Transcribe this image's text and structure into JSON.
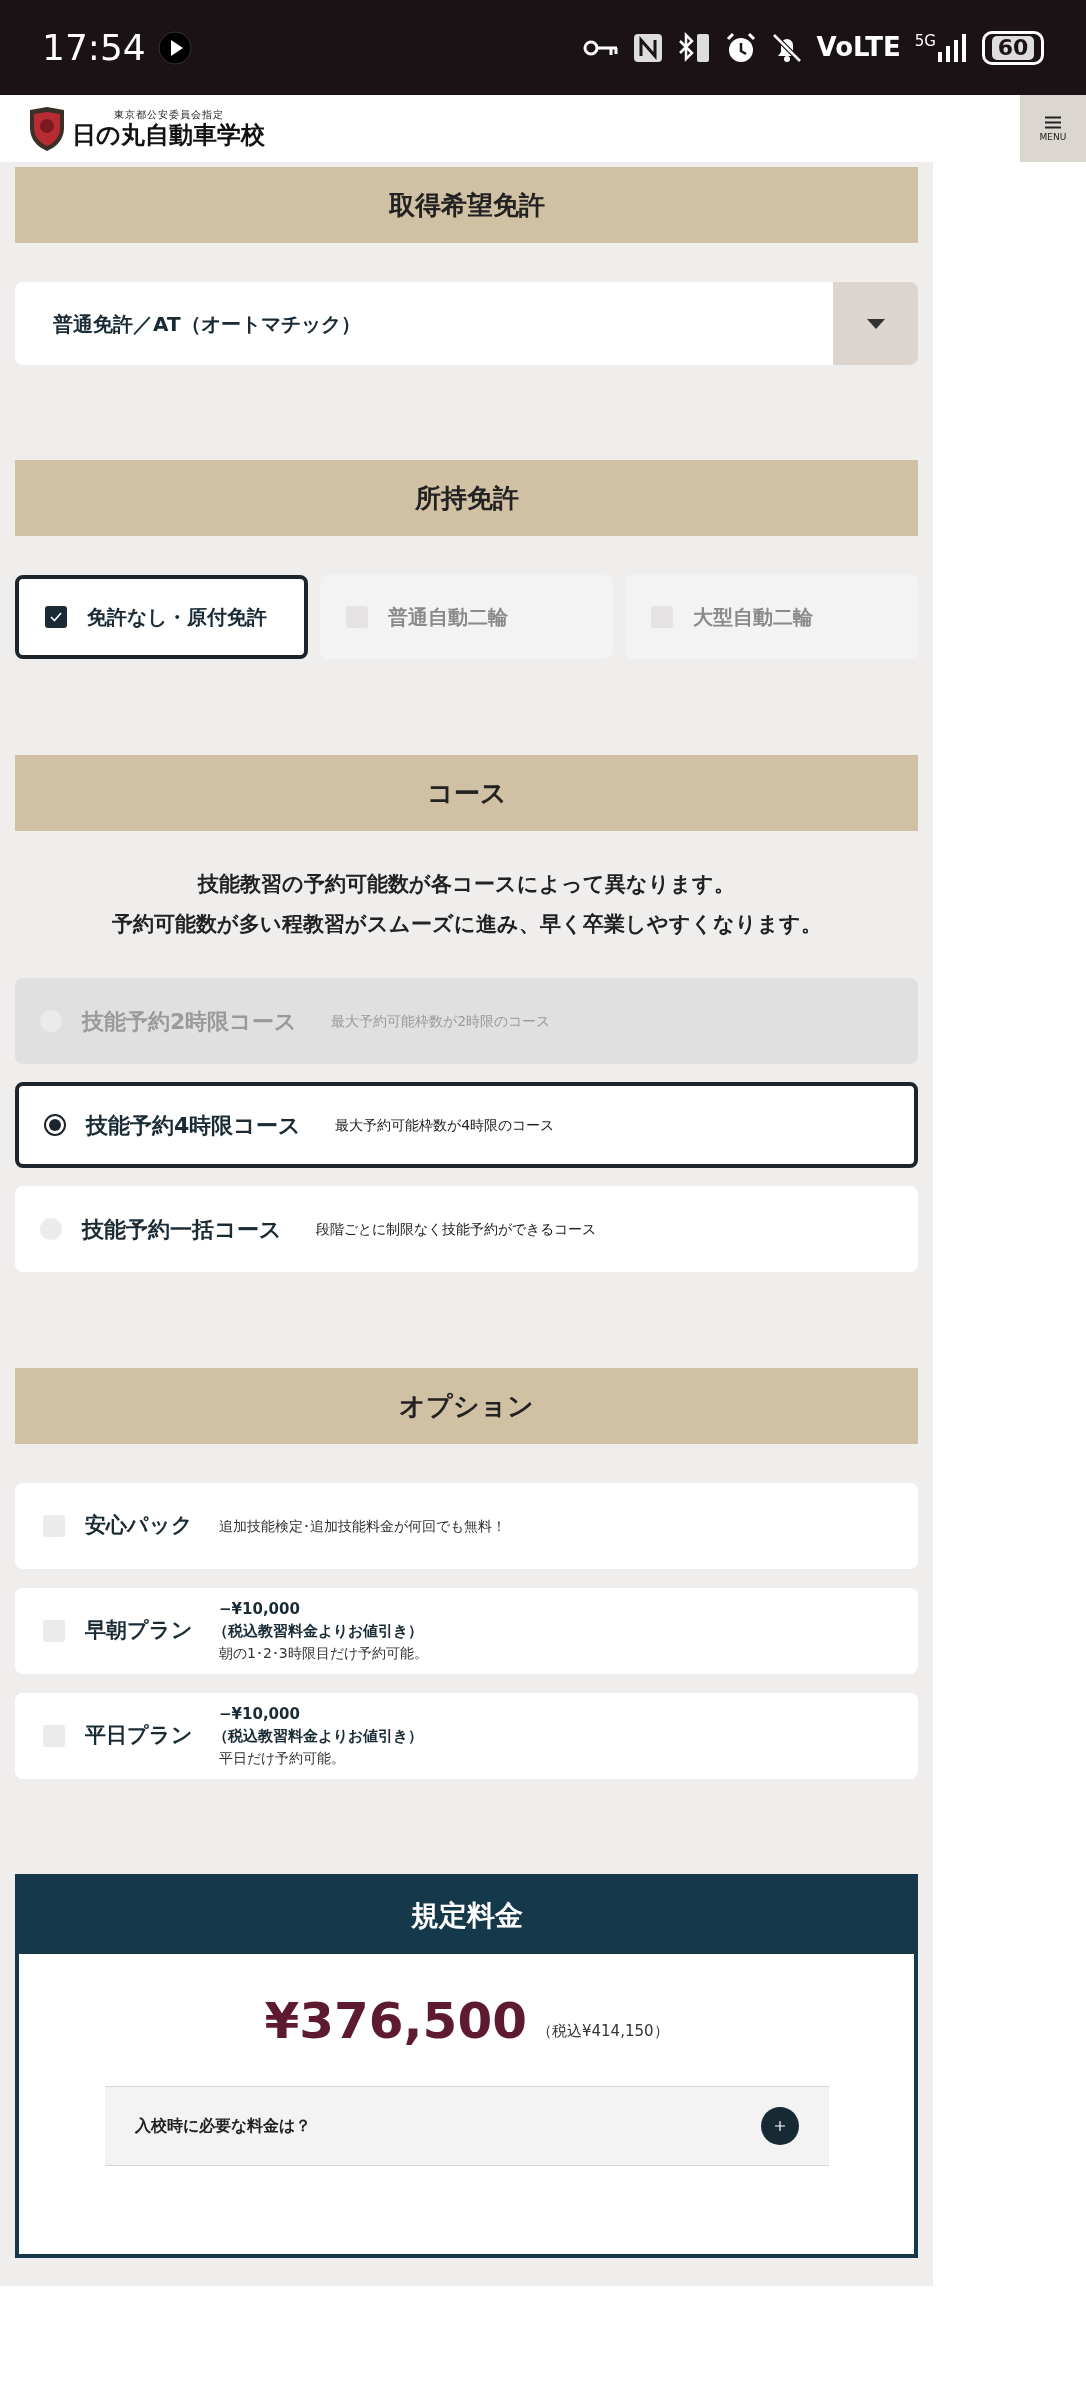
{
  "status_bar": {
    "time": "17:54",
    "network_label": "VoLTE",
    "network_type": "5G",
    "battery": "60"
  },
  "header": {
    "logo_caption": "東京都公安委員会指定",
    "logo_text": "日の丸自動車学校",
    "menu_label": "MENU"
  },
  "desired_license": {
    "heading": "取得希望免許",
    "select_value": "普通免許／AT（オートマチック）"
  },
  "held_license": {
    "heading": "所持免許",
    "options": [
      {
        "label": "免許なし・原付免許",
        "checked": true,
        "disabled": false
      },
      {
        "label": "普通自動二輪",
        "checked": false,
        "disabled": true
      },
      {
        "label": "大型自動二輪",
        "checked": false,
        "disabled": true
      }
    ]
  },
  "course": {
    "heading": "コース",
    "description_lines": [
      "技能教習の予約可能数が各コースによって異なります。",
      "予約可能数が多い程教習がスムーズに進み、早く卒業しやすくなります。"
    ],
    "courses": [
      {
        "name": "技能予約2時限コース",
        "note": "最大予約可能枠数が2時限のコース",
        "selected": false,
        "disabled": true
      },
      {
        "name": "技能予約4時限コース",
        "note": "最大予約可能枠数が4時限のコース",
        "selected": true,
        "disabled": false
      },
      {
        "name": "技能予約一括コース",
        "note": "段階ごとに制限なく技能予約ができるコース",
        "selected": false,
        "disabled": false
      }
    ]
  },
  "options": {
    "heading": "オプション",
    "items": [
      {
        "name": "安心パック",
        "checked": false,
        "detail": "追加技能検定･追加技能料金が何回でも無料！"
      },
      {
        "name": "早朝プラン",
        "checked": false,
        "discount": "−¥10,000",
        "discount_note": "（税込教習料金よりお値引き）",
        "detail": "朝の1･2･3時限目だけ予約可能。"
      },
      {
        "name": "平日プラン",
        "checked": false,
        "discount": "−¥10,000",
        "discount_note": "（税込教習料金よりお値引き）",
        "detail": "平日だけ予約可能。"
      }
    ]
  },
  "fee": {
    "heading": "規定料金",
    "price": "¥376,500",
    "tax_note": "（税込¥414,150）",
    "accordion": {
      "question": "入校時に必要な料金は？",
      "expanded": false
    }
  }
}
